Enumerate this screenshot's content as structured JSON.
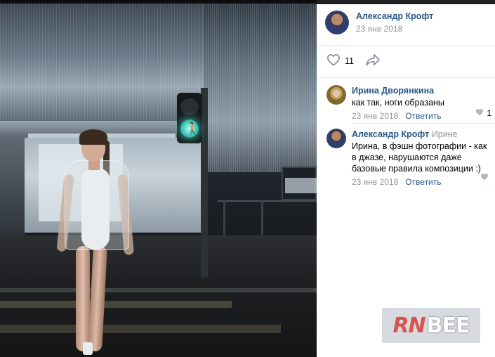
{
  "post": {
    "author_name": "Александр Крофт",
    "date": "23 янв 2018",
    "likes": "11"
  },
  "comments": [
    {
      "author": "Ирина Дворянкина",
      "text": "как так, ноги образаны",
      "date": "23 янв 2018",
      "reply_label": "Ответить",
      "likes": "1"
    },
    {
      "author": "Александр Крофт",
      "reply_to": "Ирине",
      "text": "Ирина, в фэшн фотографии - как в джазе, нарушаются даже базовые правила композиции :)",
      "date": "23 янв 2018",
      "reply_label": "Ответить",
      "likes": ""
    }
  ],
  "watermark": {
    "part1": "RN",
    "part2": "BEE"
  },
  "colors": {
    "link": "#2a5885",
    "muted": "#939393",
    "icon": "#99a2ad",
    "traffic_light_green": "#4fd3c3"
  },
  "icons": {
    "like": "heart-outline-icon",
    "share": "share-arrow-icon",
    "comment_like": "heart-filled-icon"
  }
}
